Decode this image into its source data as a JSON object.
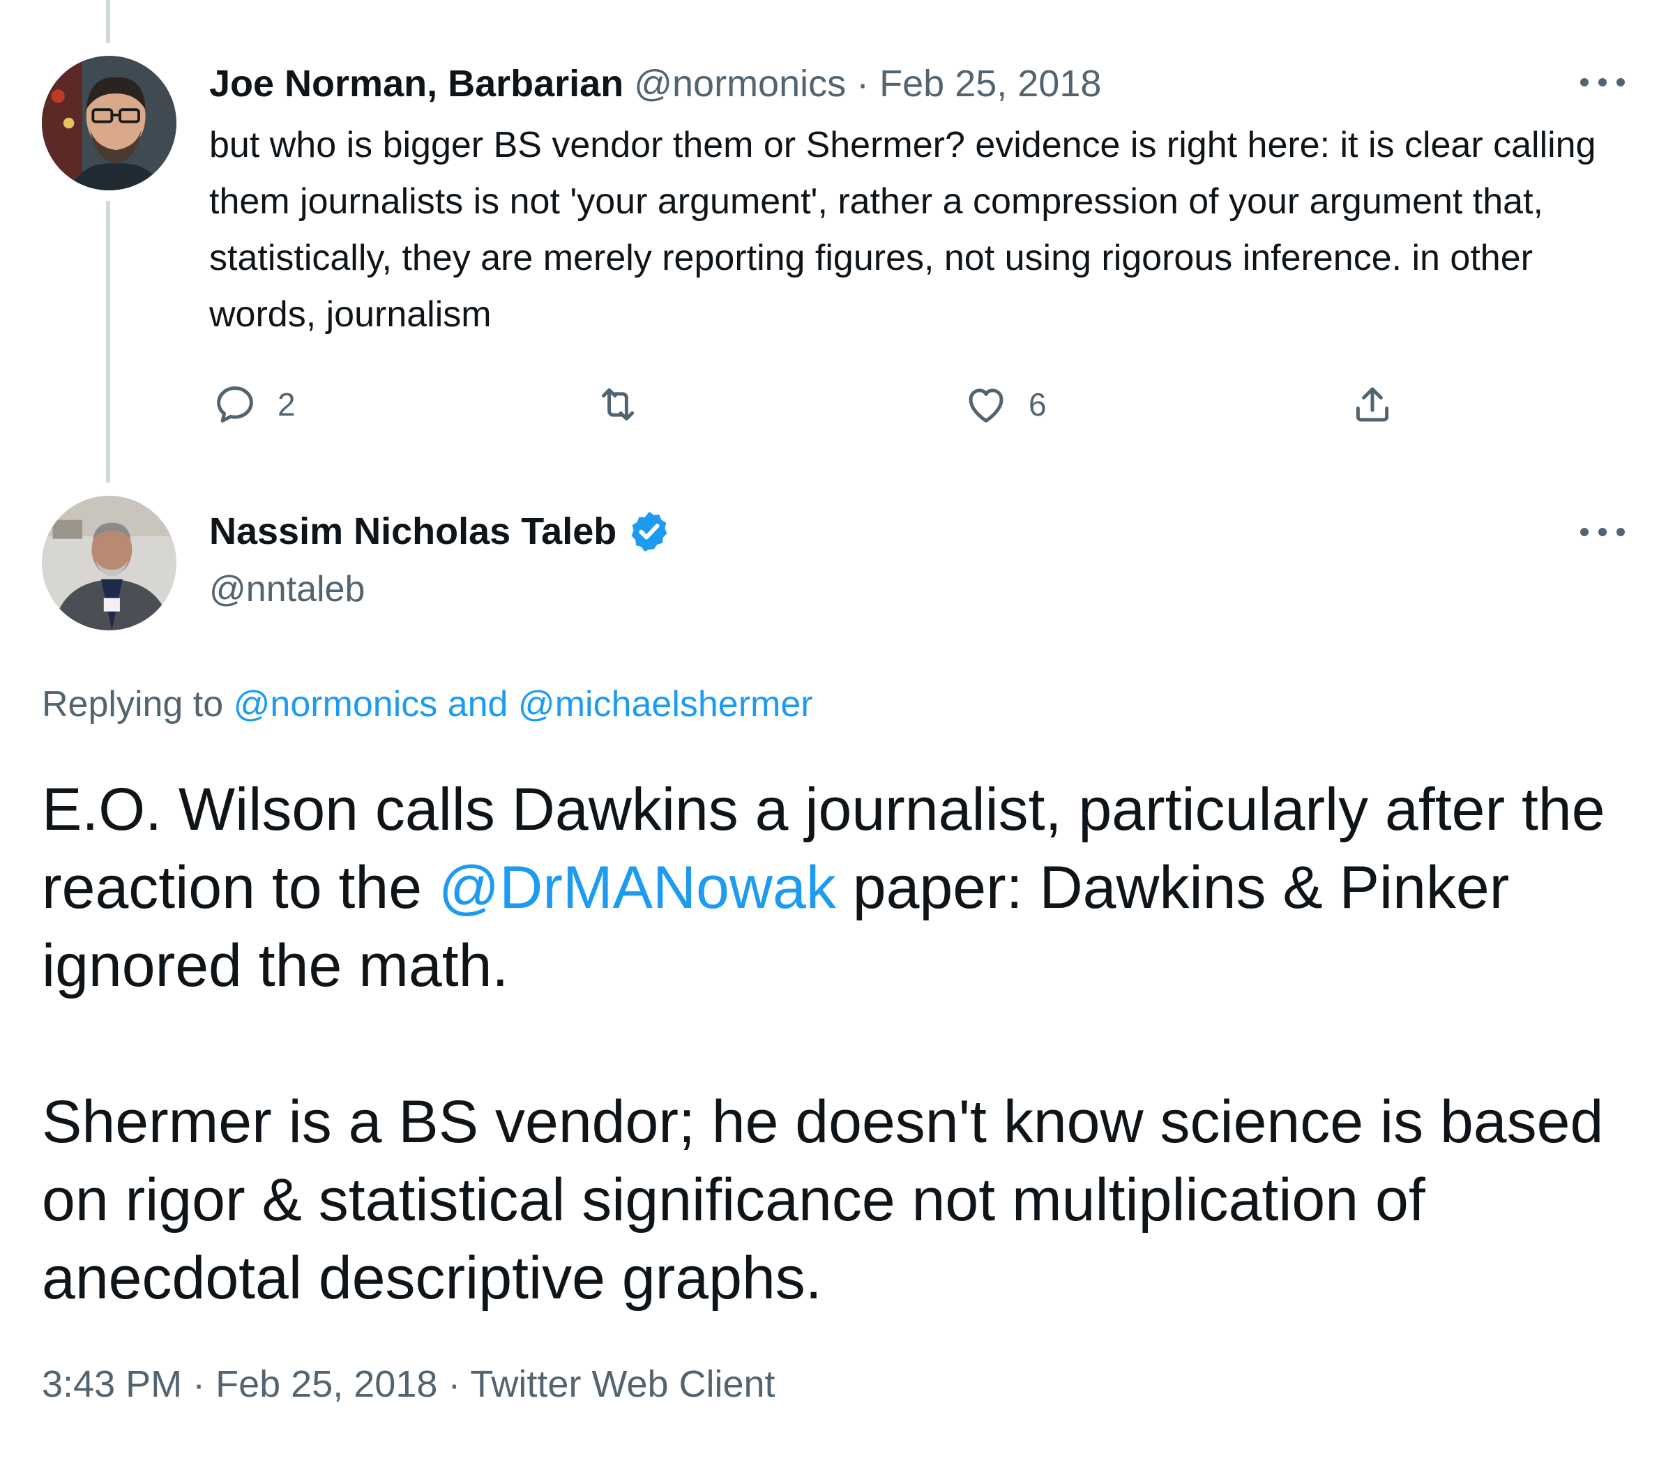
{
  "parent_tweet": {
    "display_name": "Joe Norman, Barbarian",
    "handle": "@normonics",
    "separator": "·",
    "date": "Feb 25, 2018",
    "text": "but who is bigger BS vendor them or Shermer? evidence is right here: it is clear calling them journalists is not 'your argument', rather a compression of your argument that, statistically, they are merely reporting figures, not using rigorous inference. in other words, journalism",
    "actions": {
      "reply_count": "2",
      "retweet_count": "",
      "like_count": "6"
    }
  },
  "main_tweet": {
    "display_name": "Nassim Nicholas Taleb",
    "handle": "@nntaleb",
    "replying_prefix": "Replying to",
    "replying_to": "@normonics and @michaelshermer",
    "text_part1": "E.O. Wilson calls Dawkins a journalist, particularly after the reaction to the ",
    "mention": "@DrMANowak",
    "text_part2": " paper: Dawkins & Pinker ignored the math.",
    "text_paragraph2": "Shermer is a BS vendor; he doesn't know science is based on rigor & statistical significance not multiplication of anecdotal descriptive graphs.",
    "time": "3:43 PM",
    "date": "Feb 25, 2018",
    "source": "Twitter Web Client",
    "separator": "·"
  },
  "icons": {
    "reply": "reply-icon",
    "retweet": "retweet-icon",
    "like": "heart-icon",
    "share": "share-icon",
    "more": "more-icon",
    "verified": "verified-badge-icon"
  },
  "colors": {
    "accent": "#1d9bf0",
    "text": "#0f1419",
    "muted": "#536471",
    "thread_line": "#cfd9de"
  }
}
